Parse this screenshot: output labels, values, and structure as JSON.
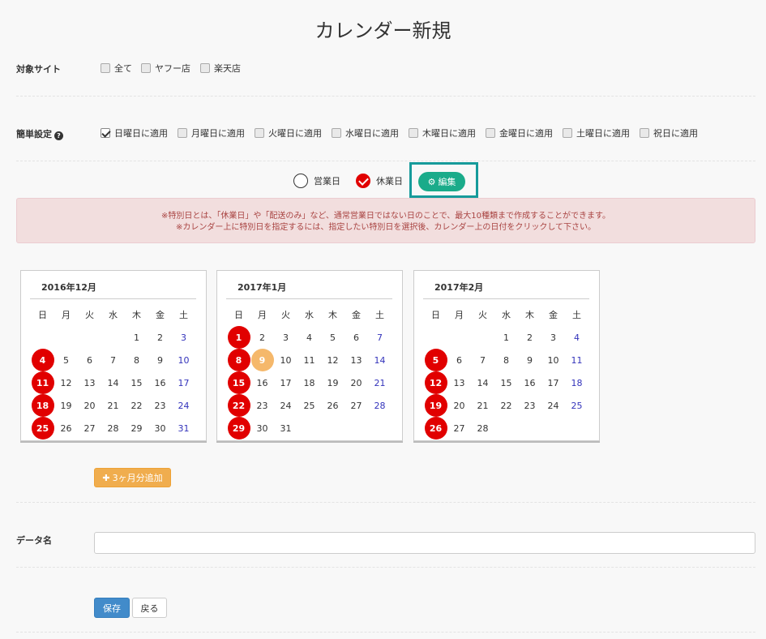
{
  "title": "カレンダー新規",
  "target_site": {
    "label": "対象サイト",
    "options": [
      {
        "label": "全て",
        "checked": false
      },
      {
        "label": "ヤフー店",
        "checked": false
      },
      {
        "label": "楽天店",
        "checked": false
      }
    ]
  },
  "simple_setting": {
    "label": "簡単設定",
    "help_icon": "question-circle-icon",
    "options": [
      {
        "label": "日曜日に適用",
        "checked": true
      },
      {
        "label": "月曜日に適用",
        "checked": false
      },
      {
        "label": "火曜日に適用",
        "checked": false
      },
      {
        "label": "水曜日に適用",
        "checked": false
      },
      {
        "label": "木曜日に適用",
        "checked": false
      },
      {
        "label": "金曜日に適用",
        "checked": false
      },
      {
        "label": "土曜日に適用",
        "checked": false
      },
      {
        "label": "祝日に適用",
        "checked": false
      }
    ]
  },
  "day_type": {
    "business_label": "営業日",
    "holiday_label": "休業日",
    "selected": "休業日",
    "edit_label": "編集",
    "edit_icon": "gear-icon"
  },
  "alert": {
    "line1": "※特別日とは、「休業日」や「配送のみ」など、通常営業日ではない日のことで、最大10種類まで作成することができます。",
    "line2": "※カレンダー上に特別日を指定するには、指定したい特別日を選択後、カレンダー上の日付をクリックして下さい。"
  },
  "weekdays": [
    "日",
    "月",
    "火",
    "水",
    "木",
    "金",
    "土"
  ],
  "calendars": [
    {
      "title": "2016年12月",
      "offset": 4,
      "days": 31,
      "holidays": [
        4,
        11,
        18,
        25
      ],
      "highlight": []
    },
    {
      "title": "2017年1月",
      "offset": 0,
      "days": 31,
      "holidays": [
        1,
        8,
        15,
        22,
        29
      ],
      "highlight": [
        9
      ]
    },
    {
      "title": "2017年2月",
      "offset": 3,
      "days": 28,
      "holidays": [
        5,
        12,
        19,
        26
      ],
      "highlight": []
    }
  ],
  "add_button": {
    "label": "3ヶ月分追加",
    "icon": "plus-icon"
  },
  "data_name": {
    "label": "データ名",
    "value": "",
    "placeholder": ""
  },
  "save_label": "保存",
  "back_label": "戻る",
  "colors": {
    "holiday": "#e10000",
    "today": "#f5b86b",
    "saturday": "#3333bb",
    "edit": "#1aab8a",
    "frame": "#169b9b"
  }
}
